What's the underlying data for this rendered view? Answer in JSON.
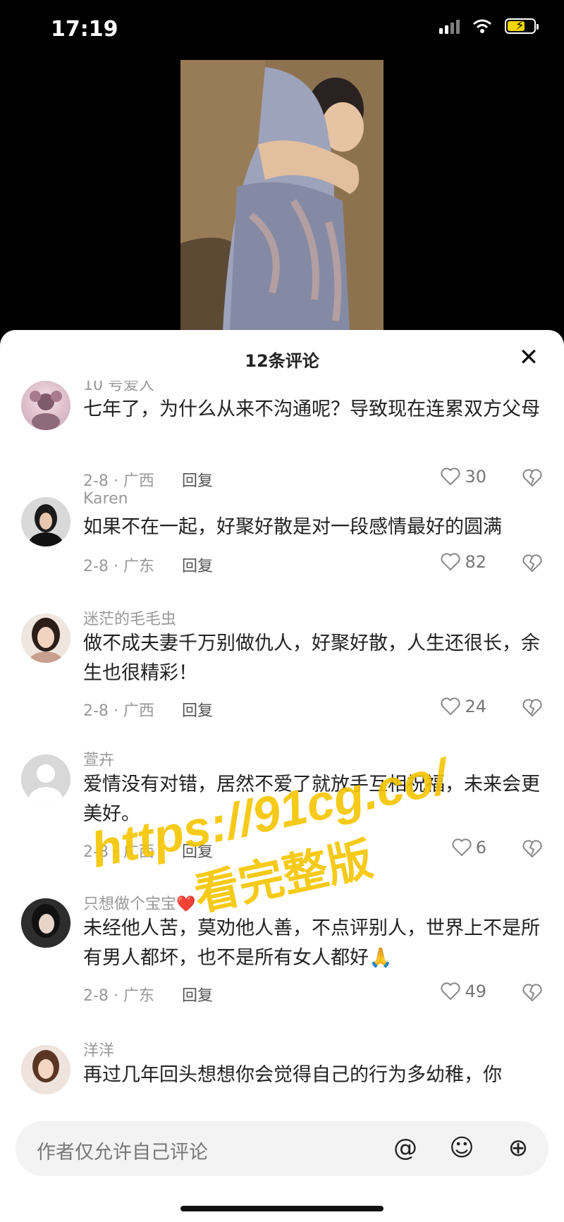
{
  "status_bar": {
    "time": "17:19"
  },
  "sheet": {
    "title": "12条评论"
  },
  "comments": [
    {
      "user": "10 号爱人",
      "text": "七年了，为什么从来不沟通呢？导致现在连累双方父母",
      "date": "2-8 · 广西",
      "reply": "回复",
      "likes": "30"
    },
    {
      "user": "Karen",
      "text": "如果不在一起，好聚好散是对一段感情最好的圆满",
      "date": "2-8 · 广东",
      "reply": "回复",
      "likes": "82"
    },
    {
      "user": "迷茫的毛毛虫",
      "text": "做不成夫妻千万别做仇人，好聚好散，人生还很长，余生也很精彩！",
      "date": "2-8 · 广西",
      "reply": "回复",
      "likes": "24"
    },
    {
      "user": "萱卉",
      "text": "爱情没有对错，居然不爱了就放手互相祝福，未来会更美好。",
      "date": "2-8 · 广西",
      "reply": "回复",
      "likes": "6"
    },
    {
      "user": "只想做个宝宝❤️",
      "text": "未经他人苦，莫劝他人善，不点评别人，世界上不是所有男人都坏，也不是所有女人都好🙏",
      "date": "2-8 · 广东",
      "reply": "回复",
      "likes": "49"
    },
    {
      "user": "洋洋",
      "text": "再过几年回头想想你会觉得自己的行为多幼稚，你",
      "date": "",
      "reply": "",
      "likes": ""
    }
  ],
  "watermark": {
    "line1": "https://91cg.co/",
    "line2": "看完整版"
  },
  "input": {
    "placeholder": "作者仅允许自己评论"
  },
  "icons": {
    "close": "close-icon",
    "mention": "at-icon",
    "emoji": "emoji-icon",
    "add": "plus-icon",
    "like": "heart-icon",
    "dislike": "broken-heart-icon"
  },
  "colors": {
    "watermark": "#f5c400",
    "like_text": "#777777"
  }
}
